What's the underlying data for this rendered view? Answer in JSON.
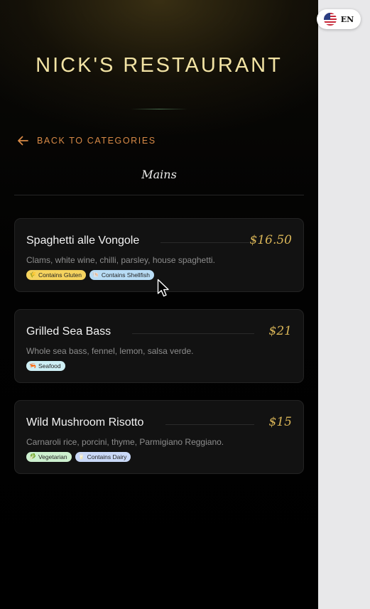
{
  "restaurant": {
    "name": "NICK'S RESTAURANT"
  },
  "nav": {
    "back_label": "BACK TO CATEGORIES",
    "back_icon": "arrow-left-icon",
    "accent": "#d88a47"
  },
  "category": {
    "title": "Mains"
  },
  "language": {
    "code": "EN",
    "flag_icon": "us-flag-icon"
  },
  "colors": {
    "price": "#d8b457",
    "title": "#f2e3a4"
  },
  "menu_items": [
    {
      "name": "Spaghetti alle Vongole",
      "price": "$16.50",
      "description": "Clams, white wine, chilli, parsley, house spaghetti.",
      "tags": [
        {
          "label": "Contains Gluten",
          "icon": "wheat-icon",
          "glyph": "🌾",
          "bg": "#f5d35e"
        },
        {
          "label": "Contains Shellfish",
          "icon": "shell-icon",
          "glyph": "🐚",
          "bg": "#b8dcf5"
        }
      ]
    },
    {
      "name": "Grilled Sea Bass",
      "price": "$21",
      "description": "Whole sea bass, fennel, lemon, salsa verde.",
      "tags": [
        {
          "label": "Seafood",
          "icon": "shrimp-icon",
          "glyph": "🦐",
          "bg": "#cdeef4"
        }
      ]
    },
    {
      "name": "Wild Mushroom Risotto",
      "price": "$15",
      "description": "Carnaroli rice, porcini, thyme, Parmigiano Reggiano.",
      "tags": [
        {
          "label": "Vegetarian",
          "icon": "leaf-icon",
          "glyph": "🥬",
          "bg": "#cdf0cf"
        },
        {
          "label": "Contains Dairy",
          "icon": "milk-icon",
          "glyph": "🥛",
          "bg": "#c9d8f7"
        }
      ]
    }
  ]
}
